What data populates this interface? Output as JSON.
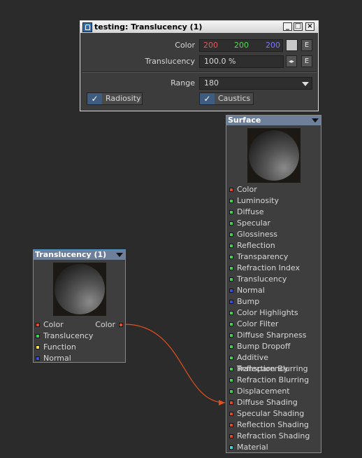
{
  "panel": {
    "title": "testing: Translucency (1)",
    "window_buttons": [
      "_",
      "□",
      "×"
    ],
    "color_label": "Color",
    "color_r": "200",
    "color_g": "200",
    "color_b": "200",
    "swatch_color": "#c8c8c8",
    "envelope_label": "E",
    "translucency_label": "Translucency",
    "translucency_value": "100.0 %",
    "range_label": "Range",
    "range_value": "180",
    "radiosity_label": "Radiosity",
    "radiosity_checked": true,
    "caustics_label": "Caustics",
    "caustics_checked": true
  },
  "translucency_node": {
    "title": "Translucency (1)",
    "inputs": [
      {
        "label": "Color",
        "color": "#e04a2a"
      },
      {
        "label": "Translucency",
        "color": "#3bd15b"
      },
      {
        "label": "Function",
        "color": "#f0e23a"
      },
      {
        "label": "Normal",
        "color": "#3a52e0"
      }
    ],
    "output": {
      "label": "Color",
      "color": "#e04a2a"
    }
  },
  "surface_node": {
    "title": "Surface",
    "inputs": [
      {
        "label": "Color",
        "color": "#e04a2a"
      },
      {
        "label": "Luminosity",
        "color": "#3bd15b"
      },
      {
        "label": "Diffuse",
        "color": "#3bd15b"
      },
      {
        "label": "Specular",
        "color": "#3bd15b"
      },
      {
        "label": "Glossiness",
        "color": "#3bd15b"
      },
      {
        "label": "Reflection",
        "color": "#3bd15b"
      },
      {
        "label": "Transparency",
        "color": "#3bd15b"
      },
      {
        "label": "Refraction Index",
        "color": "#3bd15b"
      },
      {
        "label": "Translucency",
        "color": "#3bd15b"
      },
      {
        "label": "Normal",
        "color": "#3a52e0"
      },
      {
        "label": "Bump",
        "color": "#3a52e0"
      },
      {
        "label": "Color Highlights",
        "color": "#3bd15b"
      },
      {
        "label": "Color Filter",
        "color": "#3bd15b"
      },
      {
        "label": "Diffuse Sharpness",
        "color": "#3bd15b"
      },
      {
        "label": "Bump Dropoff",
        "color": "#3bd15b"
      },
      {
        "label": "Additive Transparency",
        "color": "#3bd15b"
      },
      {
        "label": "Reflection Blurring",
        "color": "#3bd15b"
      },
      {
        "label": "Refraction Blurring",
        "color": "#3bd15b"
      },
      {
        "label": "Displacement",
        "color": "#3bd15b"
      },
      {
        "label": "Diffuse Shading",
        "color": "#e04a2a"
      },
      {
        "label": "Specular Shading",
        "color": "#e04a2a"
      },
      {
        "label": "Reflection Shading",
        "color": "#e04a2a"
      },
      {
        "label": "Refraction Shading",
        "color": "#e04a2a"
      },
      {
        "label": "Material",
        "color": "#3ad8e0"
      }
    ]
  },
  "connection": {
    "color": "#e2501e"
  }
}
